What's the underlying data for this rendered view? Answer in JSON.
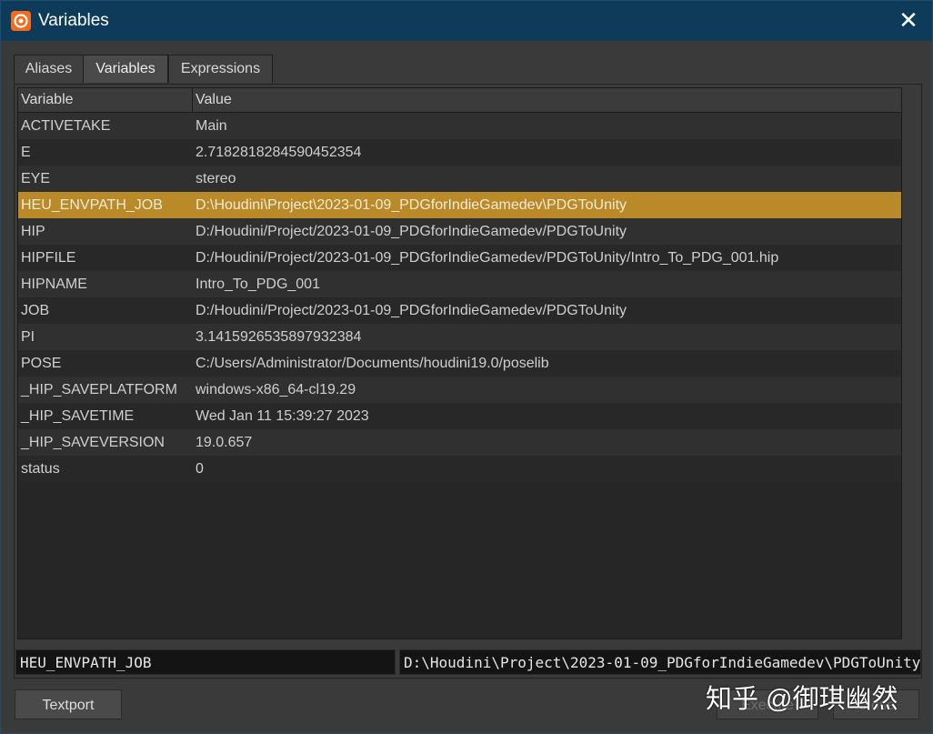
{
  "window": {
    "title": "Variables",
    "accent": "#0e3b59",
    "selected_color": "#b98a27"
  },
  "tabs": [
    {
      "label": "Aliases"
    },
    {
      "label": "Variables"
    },
    {
      "label": "Expressions"
    }
  ],
  "active_tab": "Variables",
  "table": {
    "columns": [
      "Variable",
      "Value"
    ],
    "rows": [
      {
        "variable": "ACTIVETAKE",
        "value": "Main"
      },
      {
        "variable": "E",
        "value": "2.7182818284590452354"
      },
      {
        "variable": "EYE",
        "value": "stereo"
      },
      {
        "variable": "HEU_ENVPATH_JOB",
        "value": "D:\\Houdini\\Project\\2023-01-09_PDGforIndieGamedev\\PDGToUnity",
        "selected": true
      },
      {
        "variable": "HIP",
        "value": "D:/Houdini/Project/2023-01-09_PDGforIndieGamedev/PDGToUnity"
      },
      {
        "variable": "HIPFILE",
        "value": "D:/Houdini/Project/2023-01-09_PDGforIndieGamedev/PDGToUnity/Intro_To_PDG_001.hip"
      },
      {
        "variable": "HIPNAME",
        "value": "Intro_To_PDG_001"
      },
      {
        "variable": "JOB",
        "value": "D:/Houdini/Project/2023-01-09_PDGforIndieGamedev/PDGToUnity"
      },
      {
        "variable": "PI",
        "value": "3.1415926535897932384"
      },
      {
        "variable": "POSE",
        "value": "C:/Users/Administrator/Documents/houdini19.0/poselib"
      },
      {
        "variable": "_HIP_SAVEPLATFORM",
        "value": "windows-x86_64-cl19.29"
      },
      {
        "variable": "_HIP_SAVETIME",
        "value": "Wed Jan 11 15:39:27 2023"
      },
      {
        "variable": "_HIP_SAVEVERSION",
        "value": "19.0.657"
      },
      {
        "variable": "status",
        "value": "0"
      }
    ]
  },
  "edit": {
    "name_value": "HEU_ENVPATH_JOB",
    "value_value": "D:\\Houdini\\Project\\2023-01-09_PDGforIndieGamedev\\PDGToUnity"
  },
  "buttons": {
    "textport": "Textport",
    "execute": "Execute",
    "close": "Close"
  },
  "watermark": "知乎 @御琪幽然",
  "icons": {
    "app": "houdini-logo-icon",
    "close": "close-icon"
  }
}
